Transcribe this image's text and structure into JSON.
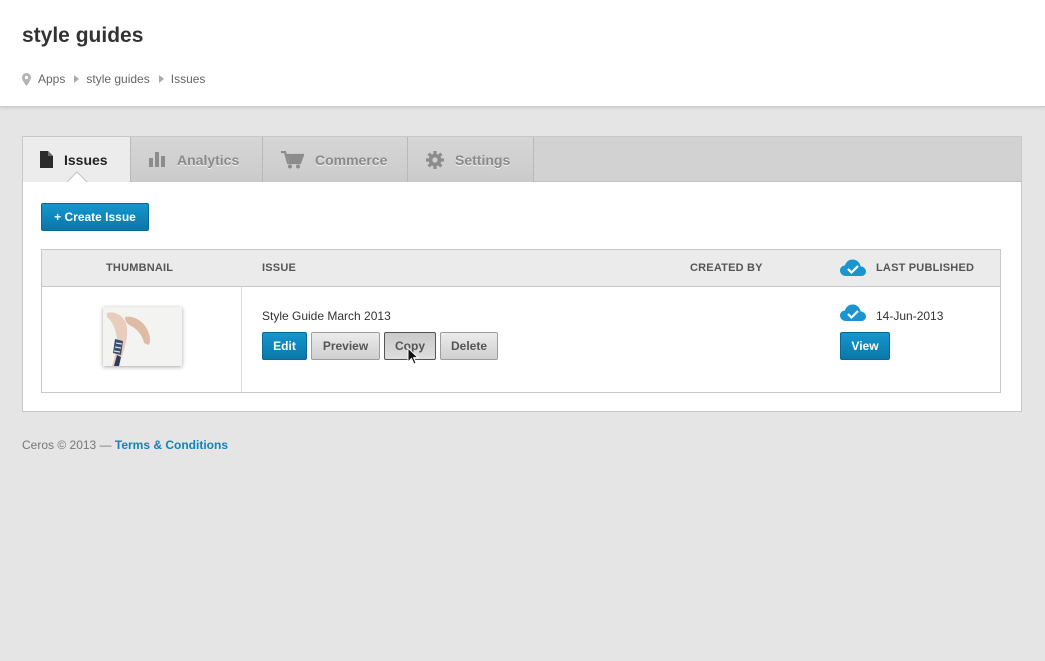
{
  "header": {
    "title": "style guides",
    "breadcrumb": [
      "Apps",
      "style guides",
      "Issues"
    ]
  },
  "tabs": [
    {
      "label": "Issues",
      "icon": "document-icon",
      "active": true
    },
    {
      "label": "Analytics",
      "icon": "bar-chart-icon",
      "active": false
    },
    {
      "label": "Commerce",
      "icon": "cart-icon",
      "active": false
    },
    {
      "label": "Settings",
      "icon": "gear-icon",
      "active": false
    }
  ],
  "create_button": "+ Create Issue",
  "table": {
    "columns": [
      "THUMBNAIL",
      "ISSUE",
      "CREATED BY",
      "LAST PUBLISHED"
    ],
    "rows": [
      {
        "issue": "Style Guide March 2013",
        "created_by": "",
        "last_published": "14-Jun-2013",
        "actions": [
          "Edit",
          "Preview",
          "Copy",
          "Delete"
        ],
        "view_label": "View"
      }
    ]
  },
  "footer": {
    "copyright": "Ceros © 2013 — ",
    "link": "Terms & Conditions"
  },
  "colors": {
    "accent": "#0a86bd",
    "cloud": "#1a95cf",
    "background": "#e5e5e5"
  }
}
